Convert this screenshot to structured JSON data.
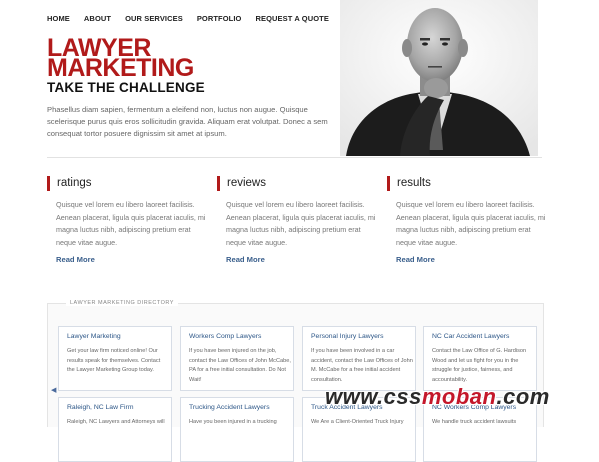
{
  "nav": [
    "HOME",
    "ABOUT",
    "OUR SERVICES",
    "PORTFOLIO",
    "REQUEST A QUOTE"
  ],
  "hero": {
    "title_line1": "LAWYER",
    "title_line2": "MARKETING",
    "subtitle": "TAKE THE CHALLENGE",
    "text": "Phasellus diam sapien, fermentum a eleifend non, luctus non augue. Quisque scelerisque purus quis eros sollicitudin gravida. Aliquam erat volutpat. Donec a sem consequat tortor posuere dignissim sit amet at ipsum."
  },
  "columns": [
    {
      "heading": "ratings",
      "text": "Quisque vel lorem eu libero laoreet facilisis. Aenean placerat, ligula quis placerat iaculis, mi magna luctus nibh, adipiscing pretium erat neque vitae augue.",
      "link": "Read More"
    },
    {
      "heading": "reviews",
      "text": "Quisque vel lorem eu libero laoreet facilisis. Aenean placerat, ligula quis placerat iaculis, mi magna luctus nibh, adipiscing pretium erat neque vitae augue.",
      "link": "Read More"
    },
    {
      "heading": "results",
      "text": "Quisque vel lorem eu libero laoreet facilisis. Aenean placerat, ligula quis placerat iaculis, mi magna luctus nibh, adipiscing pretium erat neque vitae augue.",
      "link": "Read More"
    }
  ],
  "directory": {
    "label": "LAWYER MARKETING DIRECTORY",
    "cards": [
      {
        "title": "Lawyer Marketing",
        "text": "Get your law firm noticed online! Our results speak for themselves. Contact the Lawyer Marketing Group today."
      },
      {
        "title": "Workers Comp Lawyers",
        "text": "If you have been injured on the job, contact the Law Offices of John McCabe, PA for a free initial consultation. Do Not Wait!"
      },
      {
        "title": "Personal Injury Lawyers",
        "text": "If you have been involved in a car accident, contact the Law Offices of John M. McCabe for a free initial accident consultation."
      },
      {
        "title": "NC Car Accident Lawyers",
        "text": "Contact the Law Office of G. Hardison Wood and let us fight for you in the struggle for justice, fairness, and accountability."
      },
      {
        "title": "Raleigh, NC Law Firm",
        "text": "Raleigh, NC Lawyers and Attorneys will"
      },
      {
        "title": "Trucking Accident Lawyers",
        "text": "Have you been injured in a trucking"
      },
      {
        "title": "Truck Accident Lawyers",
        "text": "We Are a Client-Oriented Truck Injury"
      },
      {
        "title": "NC Workers Comp Lawyers",
        "text": "We handle truck accident lawsuits"
      }
    ]
  },
  "watermark": {
    "part1": "www.css",
    "part2": "moban",
    "part3": ".com"
  },
  "colors": {
    "accent": "#b11a1a",
    "link": "#3a5f8c"
  }
}
